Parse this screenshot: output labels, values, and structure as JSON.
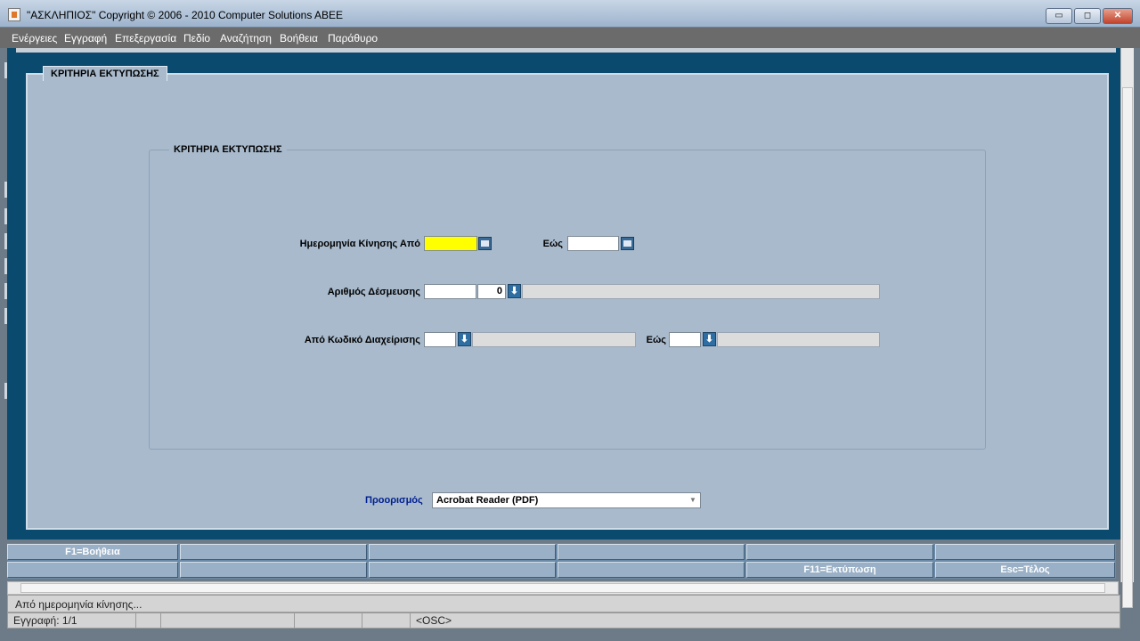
{
  "window": {
    "title": "\"ΑΣΚΛΗΠΙΟΣ\" Copyright © 2006 - 2010 Computer Solutions ABEE",
    "minimize_glyph": "▭",
    "maximize_glyph": "◻",
    "close_glyph": "✕"
  },
  "menu": {
    "items": [
      "Ενέργειες",
      "Εγγραφή",
      "Επεξεργασία",
      "Πεδίο",
      "Αναζήτηση",
      "Βοήθεια",
      "Παράθυρο"
    ]
  },
  "tab": {
    "label": "ΚΡΙΤΗΡΙΑ ΕΚΤΥΠΩΣΗΣ"
  },
  "criteria": {
    "group_label": "ΚΡΙΤΗΡΙΑ ΕΚΤΥΠΩΣΗΣ",
    "date_from_label": "Ημερομηνία Κίνησης Από",
    "date_from_value": "",
    "date_to_label": "Εώς",
    "date_to_value": "",
    "commitment_label": "Αριθμός Δέσμευσης",
    "commitment_number": "",
    "commitment_sub": "0",
    "commitment_desc": "",
    "mgmt_from_label": "Από Κωδικό Διαχείρισης",
    "mgmt_from_code": "",
    "mgmt_from_desc": "",
    "mgmt_to_label": "Εώς",
    "mgmt_to_code": "",
    "mgmt_to_desc": "",
    "lov_glyph": "⬇"
  },
  "destination": {
    "label": "Προορισμός",
    "selected": "Acrobat Reader (PDF)",
    "arrow_glyph": "▼"
  },
  "function_keys": {
    "row1": [
      "F1=Βοήθεια",
      "",
      "",
      "",
      "",
      ""
    ],
    "row2": [
      "",
      "",
      "",
      "",
      "F11=Εκτύπωση",
      "Esc=Τέλος"
    ]
  },
  "status": {
    "message": "Από ημερομηνία κίνησης...",
    "record": "Εγγραφή: 1/1",
    "mode": "<OSC>"
  },
  "colors": {
    "frame": "#0a4a6e",
    "canvas": "#a8bacc",
    "required_field": "#ffff00",
    "destination_label": "#001f8f"
  }
}
